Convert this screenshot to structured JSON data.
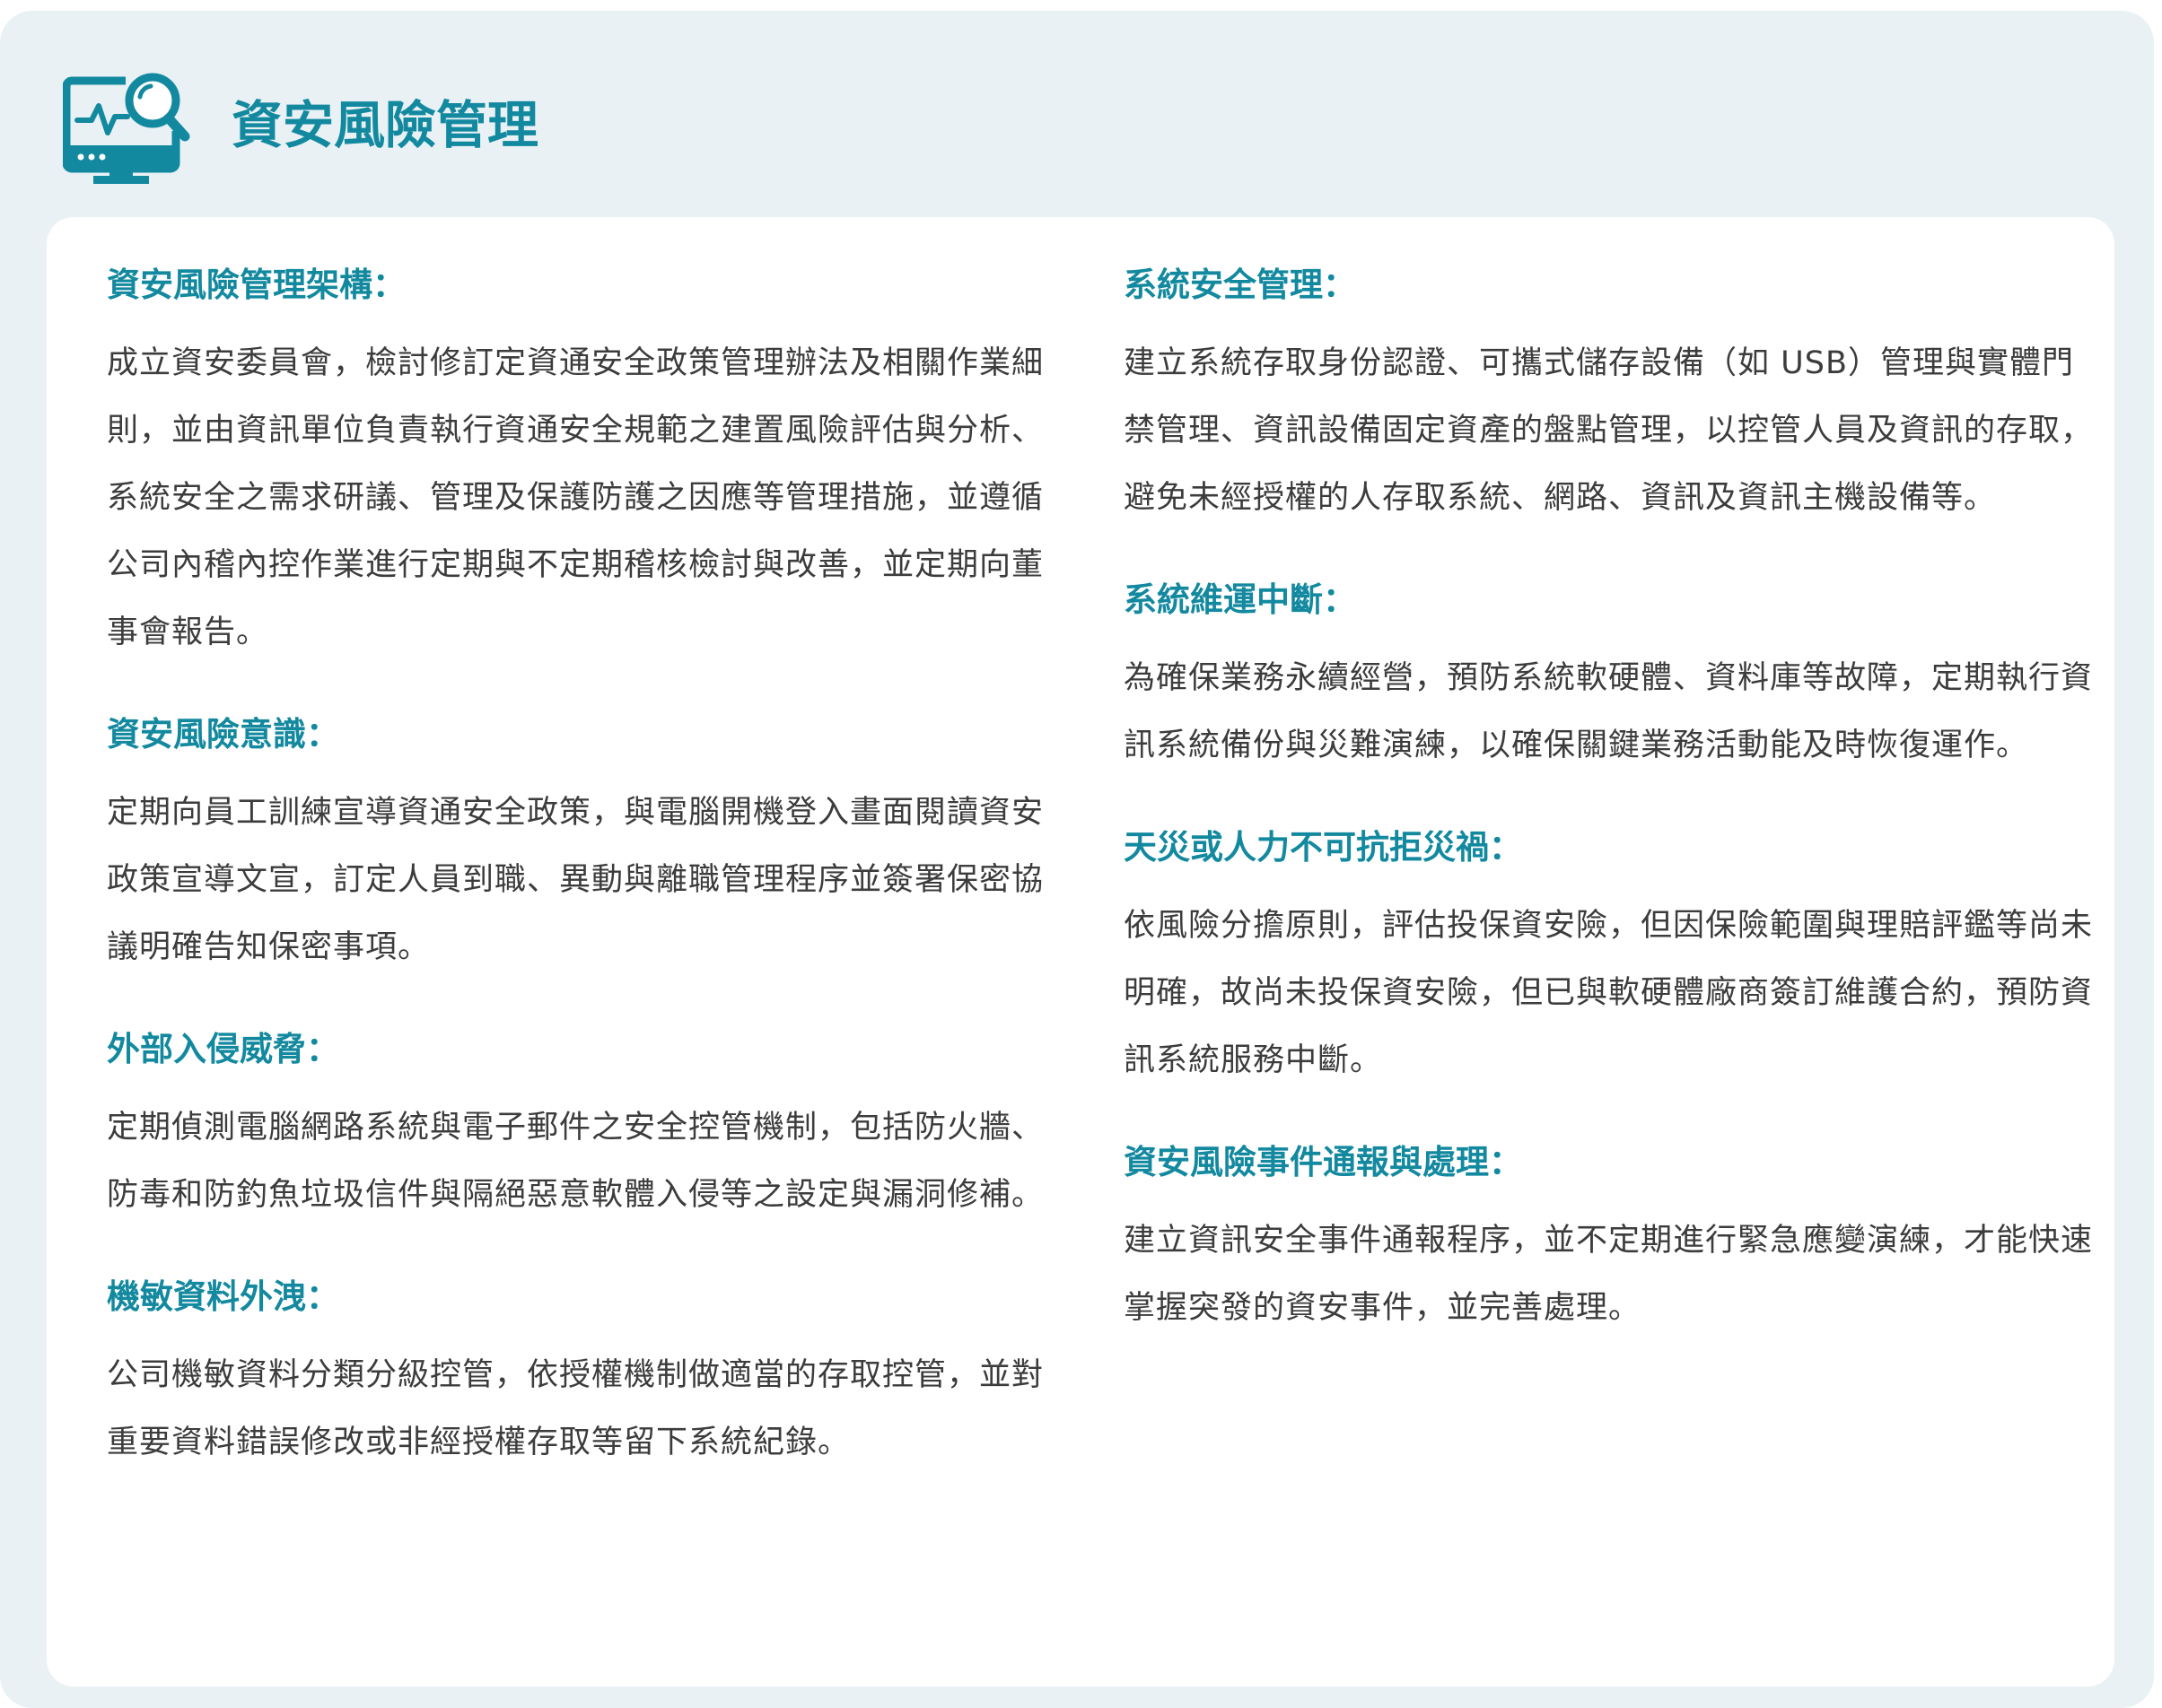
{
  "header": {
    "title": "資安風險管理",
    "icon": "monitor-search-icon",
    "accent_color": "#13899f"
  },
  "sections_left": [
    {
      "heading": "資安風險管理架構：",
      "body": "成立資安委員會，檢討修訂定資通安全政策管理辦法及相關作業細則，並由資訊單位負責執行資通安全規範之建置風險評估與分析、系統安全之需求研議、管理及保護防護之因應等管理措施，並遵循公司內稽內控作業進行定期與不定期稽核檢討與改善，並定期向董事會報告。"
    },
    {
      "heading": "資安風險意識：",
      "body": "定期向員工訓練宣導資通安全政策，與電腦開機登入畫面閱讀資安政策宣導文宣，訂定人員到職、異動與離職管理程序並簽署保密協議明確告知保密事項。"
    },
    {
      "heading": "外部入侵威脅：",
      "body": "定期偵測電腦網路系統與電子郵件之安全控管機制，包括防火牆、防毒和防釣魚垃圾信件與隔絕惡意軟體入侵等之設定與漏洞修補。"
    },
    {
      "heading": "機敏資料外洩：",
      "body": "公司機敏資料分類分級控管，依授權機制做適當的存取控管，並對重要資料錯誤修改或非經授權存取等留下系統紀錄。"
    }
  ],
  "sections_right": [
    {
      "heading": "系統安全管理：",
      "body": "建立系統存取身份認證、可攜式儲存設備（如 USB）管理與實體門禁管理、資訊設備固定資產的盤點管理，以控管人員及資訊的存取，避免未經授權的人存取系統、網路、資訊及資訊主機設備等。"
    },
    {
      "heading": "系統維運中斷：",
      "body": "為確保業務永續經營，預防系統軟硬體、資料庫等故障，定期執行資訊系統備份與災難演練，以確保關鍵業務活動能及時恢復運作。"
    },
    {
      "heading": "天災或人力不可抗拒災禍：",
      "body": "依風險分擔原則，評估投保資安險，但因保險範圍與理賠評鑑等尚未明確，故尚未投保資安險，但已與軟硬體廠商簽訂維護合約，預防資訊系統服務中斷。"
    },
    {
      "heading": "資安風險事件通報與處理：",
      "body": "建立資訊安全事件通報程序，並不定期進行緊急應變演練，才能快速掌握突發的資安事件，並完善處理。"
    }
  ]
}
